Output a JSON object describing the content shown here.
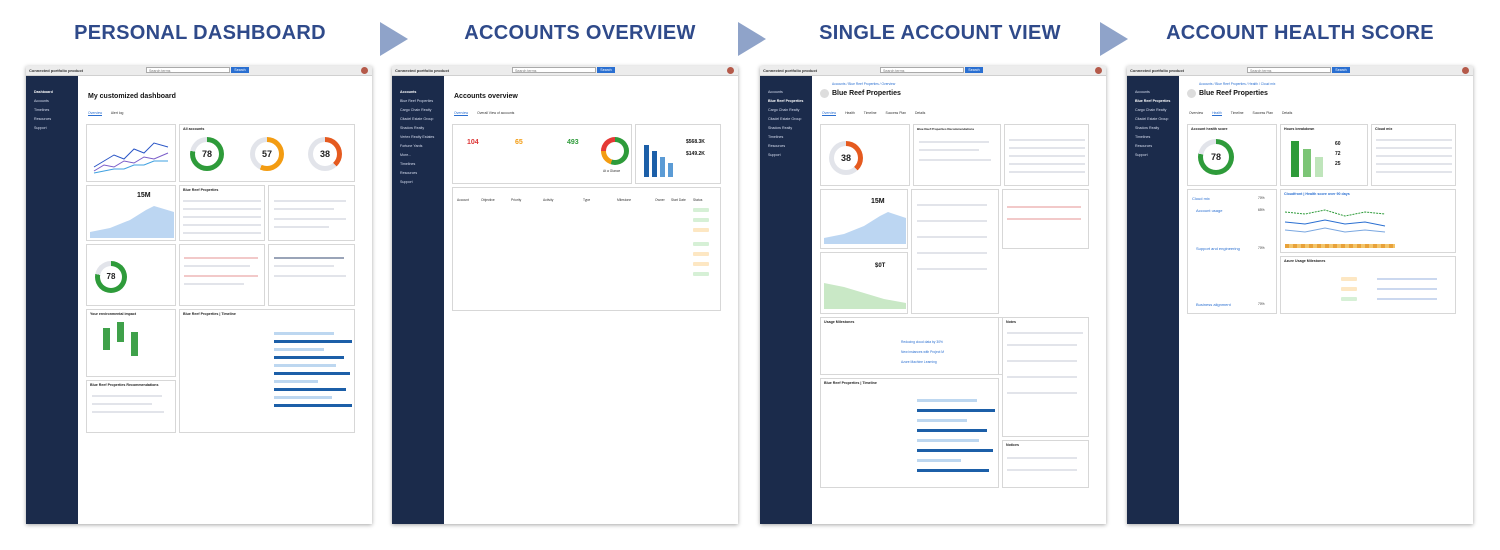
{
  "headings": [
    "PERSONAL DASHBOARD",
    "ACCOUNTS OVERVIEW",
    "SINGLE ACCOUNT VIEW",
    "ACCOUNT HEALTH SCORE"
  ],
  "colors": {
    "heading": "#2f4a8a",
    "arrow": "#8fa3c9",
    "sidebar": "#1b2b4b",
    "accent": "#2a6fd1",
    "green": "#2e9b3a",
    "orange": "#f39c12",
    "red": "#e53935"
  },
  "common": {
    "product": "Connected portfolio product",
    "search_placeholder": "Search terms",
    "search_button": "Search"
  },
  "panel1": {
    "sidebar": [
      "Dashboard",
      "Accounts",
      "Timelines",
      "Resources",
      "Support"
    ],
    "title": "My customized dashboard",
    "tabs": [
      "Overview",
      "Alert log"
    ],
    "donuts": [
      "78",
      "57",
      "38"
    ],
    "big_value": "15M",
    "donut_small": "78",
    "card_titles": [
      "All accounts",
      "Blue Reef Properties",
      "Your environmental impact",
      "Blue Reef Properties Recommendations",
      "Blue Reef Properties | Timeline"
    ]
  },
  "panel2": {
    "sidebar": [
      "Accounts",
      "Blue Reef Properties",
      "Cargo Chain Realty",
      "Citadel Estate Group",
      "Shadow Realty",
      "Vertex Realty Estates",
      "Fortune Yards",
      "More...",
      "Timelines",
      "Resources",
      "Support"
    ],
    "title": "Accounts overview",
    "tabs": [
      "Overview",
      "Overall View of accounts"
    ],
    "stats": [
      "104",
      "65",
      "493"
    ],
    "revenue_values": [
      "$568.3K",
      "$149.2K"
    ],
    "revenue_labels": [
      "All accounts",
      "At a Glance"
    ],
    "table_headers": [
      "Account",
      "Objective",
      "Priority",
      "Activity",
      "Type",
      "Milestone",
      "Owner",
      "Start Date",
      "Status"
    ],
    "statuses": [
      "Active",
      "Active",
      "Proposed",
      "Active",
      "Proposed",
      "Proposed",
      "Active"
    ]
  },
  "panel3": {
    "breadcrumb": "Accounts / Blue Reef Properties / Overview",
    "title": "Blue Reef Properties",
    "tabs": [
      "Overview",
      "Health",
      "Timeline",
      "Success Plan",
      "Details"
    ],
    "donut": "38",
    "big_value": "15M",
    "big_value2": "$0T",
    "card_titles": [
      "Blue Reef Properties Recommendations",
      "Blue Reef Properties | Cloud usage",
      "Decarbonization roadmap",
      "Usage Milestones",
      "Blue Reef Properties | Timeline",
      "Notes",
      "Notices"
    ],
    "milestones": [
      "Reducing cloud data by 30%",
      "New instances with Project M",
      "Azure Machine Learning"
    ]
  },
  "panel4": {
    "breadcrumb": "Accounts / Blue Reef Properties / Health / Cloud mix",
    "title": "Blue Reef Properties",
    "tabs": [
      "Overview",
      "Health",
      "Timeline",
      "Success Plan",
      "Details"
    ],
    "donut": "78",
    "health_items": [
      "Cloud mix",
      "Account usage",
      "Support and engineering",
      "Business alignment"
    ],
    "health_values": [
      "70%",
      "65%",
      "70%",
      "70%"
    ],
    "card_titles": [
      "Account health score",
      "Hours breakdown",
      "Cloud mix",
      "Cloudfront | Health score over 90 days",
      "Azure Usage Milestones"
    ],
    "hours": [
      "60",
      "72",
      "25"
    ]
  }
}
